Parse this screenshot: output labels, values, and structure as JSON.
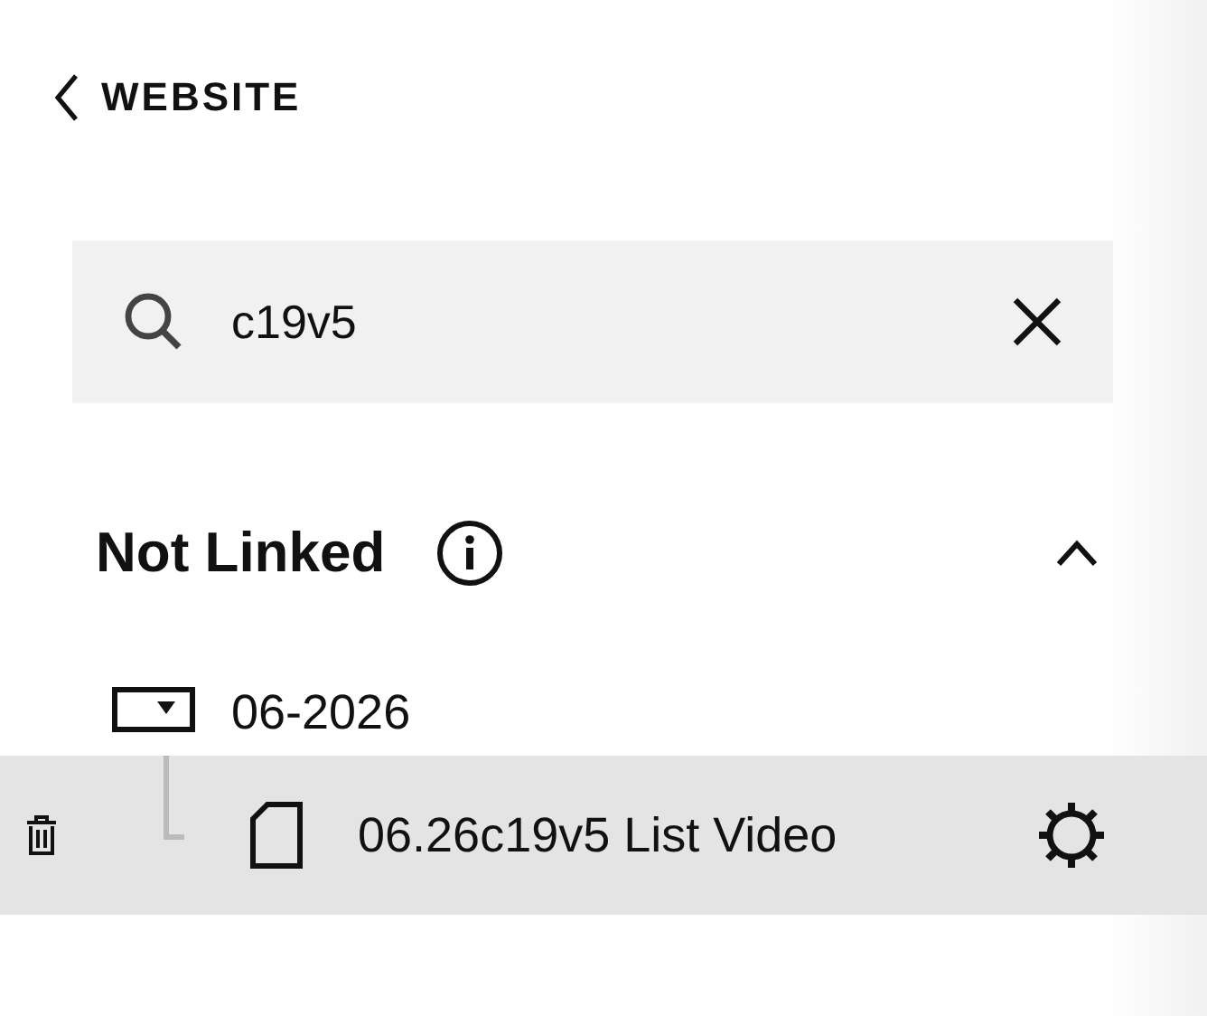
{
  "back_link": {
    "label": "WEBSITE"
  },
  "search": {
    "value": "c19v5"
  },
  "section": {
    "title": "Not Linked",
    "expanded": true,
    "items": [
      {
        "label": "06-2026",
        "kind": "folder",
        "children": [
          {
            "label": "06.26c19v5 List Video",
            "kind": "page",
            "selected": true
          }
        ]
      }
    ]
  }
}
